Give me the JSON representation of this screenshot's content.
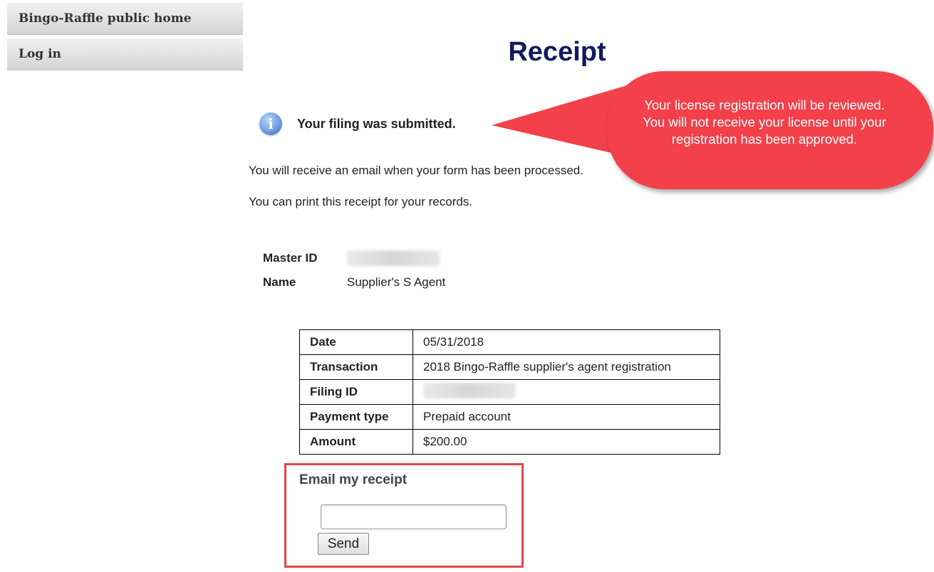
{
  "sidebar": {
    "items": [
      {
        "label": "Bingo-Raffle public home"
      },
      {
        "label": "Log in"
      }
    ]
  },
  "page": {
    "title": "Receipt",
    "info_message": "Your filing was submitted.",
    "email_notice": "You will receive an email when your form has been processed.",
    "print_notice": "You can print this receipt for your records."
  },
  "callout": {
    "text": "Your license registration will be reviewed. You will not receive your license until your registration has been approved."
  },
  "account": {
    "master_id_label": "Master ID",
    "name_label": "Name",
    "name_value": "Supplier's S Agent"
  },
  "receipt_table": {
    "rows": [
      {
        "label": "Date",
        "value": "05/31/2018"
      },
      {
        "label": "Transaction",
        "value": "2018 Bingo-Raffle supplier's agent registration"
      },
      {
        "label": "Filing ID",
        "value": ""
      },
      {
        "label": "Payment type",
        "value": "Prepaid account"
      },
      {
        "label": "Amount",
        "value": "$200.00"
      }
    ]
  },
  "email_receipt": {
    "title": "Email my receipt",
    "input_value": "",
    "send_label": "Send"
  },
  "icons": {
    "info": "info-icon"
  },
  "colors": {
    "title": "#101a60",
    "callout": "#f3404a",
    "highlight_border": "#e04548"
  }
}
